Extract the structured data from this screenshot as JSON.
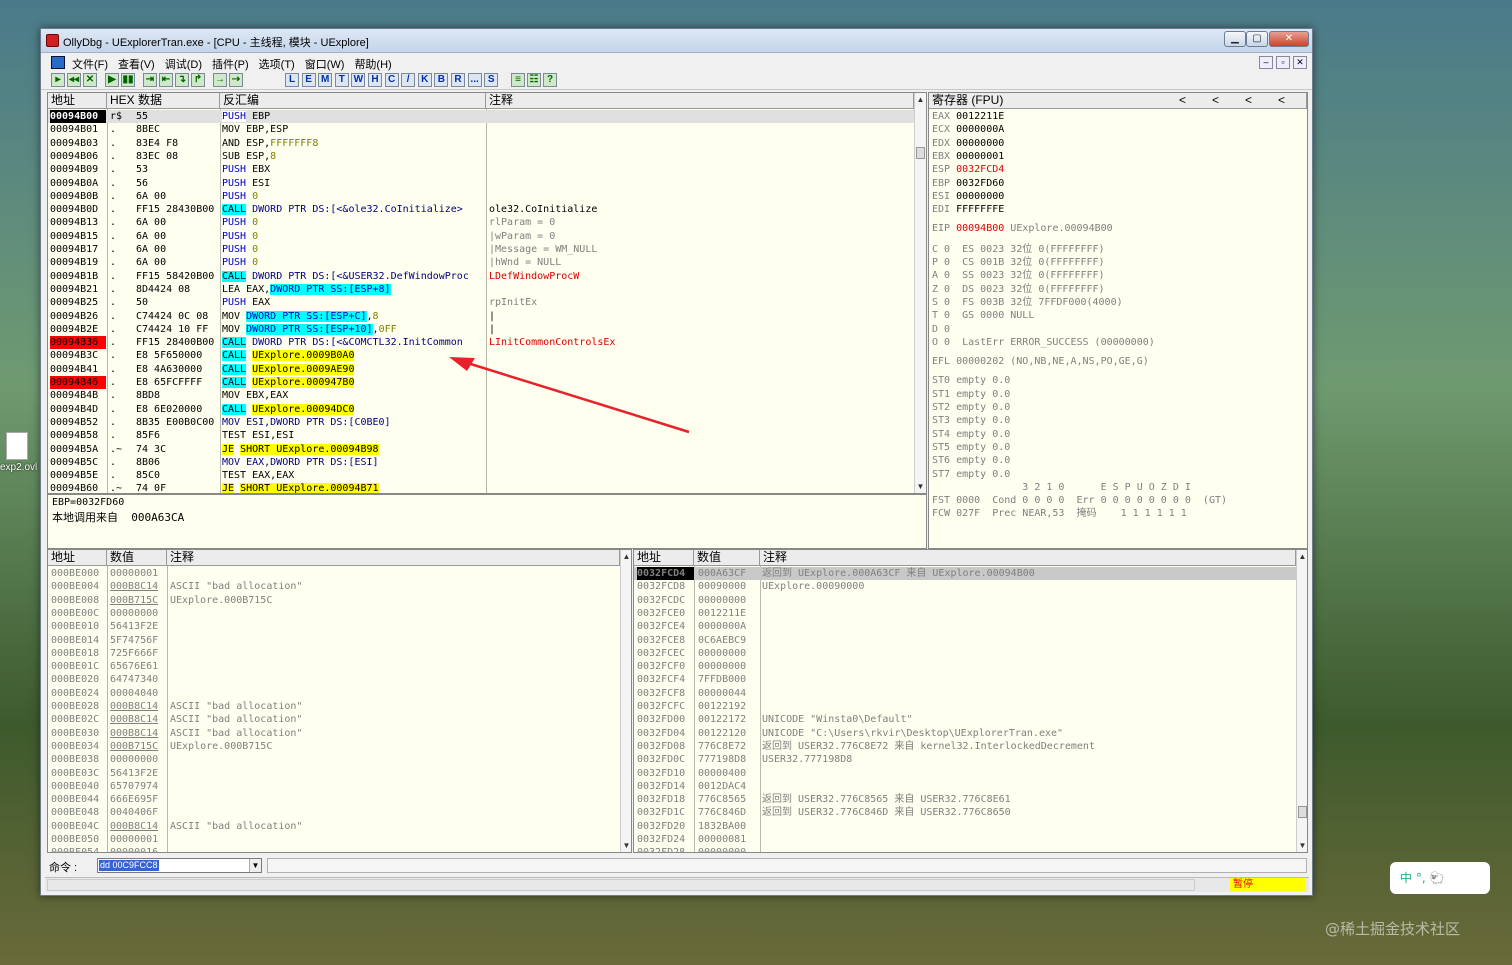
{
  "window": {
    "title": "OllyDbg - UExplorerTran.exe - [CPU - 主线程, 模块 - UExplore]",
    "min": "▁",
    "max": "▢",
    "close": "✕"
  },
  "menu": [
    "文件(F)",
    "查看(V)",
    "调试(D)",
    "插件(P)",
    "选项(T)",
    "窗口(W)",
    "帮助(H)"
  ],
  "mdi_buttons": [
    "‒",
    "▫",
    "✕"
  ],
  "toolbar": {
    "controls": [
      "▸",
      "◂◂",
      "✕",
      "▶",
      "▮▮",
      "⇥",
      "⇤",
      "↴",
      "↱",
      "→",
      "⇢"
    ],
    "windows": [
      "L",
      "E",
      "M",
      "T",
      "W",
      "H",
      "C",
      "/",
      "K",
      "B",
      "R",
      "...",
      "S"
    ],
    "extra": [
      "≡",
      "☷",
      "?"
    ]
  },
  "desktop": {
    "file_label": "exp2.ovl"
  },
  "cpu": {
    "headers": {
      "addr": "地址",
      "hex": "HEX 数据",
      "disasm": "反汇编",
      "comment": "注释"
    },
    "rows": [
      {
        "addr": "00094B00",
        "mark": "r$",
        "hex": "55",
        "disasm": [
          [
            "PUSH",
            "c"
          ],
          [
            " EBP",
            ""
          ]
        ],
        "comment": "",
        "addr_style": "sel"
      },
      {
        "addr": "00094B01",
        "mark": ".",
        "hex": "8BEC",
        "disasm": [
          [
            "MOV EBP,ESP",
            ""
          ]
        ],
        "comment": ""
      },
      {
        "addr": "00094B03",
        "mark": ".",
        "hex": "83E4 F8",
        "disasm": [
          [
            "AND ESP,",
            ""
          ],
          [
            "FFFFFFF8",
            "o"
          ]
        ],
        "comment": ""
      },
      {
        "addr": "00094B06",
        "mark": ".",
        "hex": "83EC 08",
        "disasm": [
          [
            "SUB ESP,",
            ""
          ],
          [
            "8",
            "o"
          ]
        ],
        "comment": ""
      },
      {
        "addr": "00094B09",
        "mark": ".",
        "hex": "53",
        "disasm": [
          [
            "PUSH",
            "c"
          ],
          [
            " EBX",
            ""
          ]
        ],
        "comment": ""
      },
      {
        "addr": "00094B0A",
        "mark": ".",
        "hex": "56",
        "disasm": [
          [
            "PUSH",
            "c"
          ],
          [
            " ESI",
            ""
          ]
        ],
        "comment": ""
      },
      {
        "addr": "00094B0B",
        "mark": ".",
        "hex": "6A 00",
        "disasm": [
          [
            "PUSH",
            "c"
          ],
          [
            " 0",
            "o"
          ]
        ],
        "comment": ""
      },
      {
        "addr": "00094B0D",
        "mark": ".",
        "hex": "FF15 28430B00",
        "disasm": [
          [
            "CALL",
            "cc"
          ],
          [
            " DWORD PTR DS:[<&ole32.CoInitialize>",
            "n"
          ]
        ],
        "comment": "ole32.CoInitialize"
      },
      {
        "addr": "00094B13",
        "mark": ".",
        "hex": "6A 00",
        "disasm": [
          [
            "PUSH",
            "c"
          ],
          [
            " 0",
            "o"
          ]
        ],
        "comment": "rlParam = 0",
        "cstyle": "g"
      },
      {
        "addr": "00094B15",
        "mark": ".",
        "hex": "6A 00",
        "disasm": [
          [
            "PUSH",
            "c"
          ],
          [
            " 0",
            "o"
          ]
        ],
        "comment": "|wParam = 0",
        "cstyle": "g"
      },
      {
        "addr": "00094B17",
        "mark": ".",
        "hex": "6A 00",
        "disasm": [
          [
            "PUSH",
            "c"
          ],
          [
            " 0",
            "o"
          ]
        ],
        "comment": "|Message = WM_NULL",
        "cstyle": "g"
      },
      {
        "addr": "00094B19",
        "mark": ".",
        "hex": "6A 00",
        "disasm": [
          [
            "PUSH",
            "c"
          ],
          [
            " 0",
            "o"
          ]
        ],
        "comment": "|hWnd = NULL",
        "cstyle": "g"
      },
      {
        "addr": "00094B1B",
        "mark": ".",
        "hex": "FF15 58420B00",
        "disasm": [
          [
            "CALL",
            "cc"
          ],
          [
            " DWORD PTR DS:[<&USER32.DefWindowProc",
            "n"
          ]
        ],
        "comment": "LDefWindowProcW",
        "cstyle": "r"
      },
      {
        "addr": "00094B21",
        "mark": ".",
        "hex": "8D4424 08",
        "disasm": [
          [
            "LEA EAX,",
            ""
          ],
          [
            "DWORD PTR SS:[ESP+8]",
            "cb"
          ]
        ],
        "comment": ""
      },
      {
        "addr": "00094B25",
        "mark": ".",
        "hex": "50",
        "disasm": [
          [
            "PUSH",
            "c"
          ],
          [
            " EAX",
            ""
          ]
        ],
        "comment": "rpInitEx",
        "cstyle": "g"
      },
      {
        "addr": "00094B26",
        "mark": ".",
        "hex": "C74424 0C 08",
        "disasm": [
          [
            "MOV ",
            ""
          ],
          [
            "DWORD PTR SS:[ESP+C]",
            "cb"
          ],
          [
            ",",
            ""
          ],
          [
            "8",
            "o"
          ]
        ],
        "comment": "|"
      },
      {
        "addr": "00094B2E",
        "mark": ".",
        "hex": "C74424 10 FF",
        "disasm": [
          [
            "MOV ",
            ""
          ],
          [
            "DWORD PTR SS:[ESP+10]",
            "cb"
          ],
          [
            ",",
            ""
          ],
          [
            "0FF",
            "o"
          ]
        ],
        "comment": "|"
      },
      {
        "addr": "00094B36",
        "mark": ".",
        "hex": "FF15 28400B00",
        "disasm": [
          [
            "CALL",
            "cc"
          ],
          [
            " DWORD PTR DS:[<&COMCTL32.InitCommon",
            "n"
          ]
        ],
        "comment": "LInitCommonControlsEx",
        "cstyle": "r",
        "addr_style": "red"
      },
      {
        "addr": "00094B3C",
        "mark": ".",
        "hex": "E8 5F650000",
        "disasm": [
          [
            "CALL",
            "cc"
          ],
          [
            " ",
            ""
          ],
          [
            "UExplore.0009B0A0",
            "y"
          ]
        ],
        "comment": ""
      },
      {
        "addr": "00094B41",
        "mark": ".",
        "hex": "E8 4A630000",
        "disasm": [
          [
            "CALL",
            "cc"
          ],
          [
            " ",
            ""
          ],
          [
            "UExplore.0009AE90",
            "y"
          ]
        ],
        "comment": ""
      },
      {
        "addr": "00094B46",
        "mark": ".",
        "hex": "E8 65FCFFFF",
        "disasm": [
          [
            "CALL",
            "cc"
          ],
          [
            " ",
            ""
          ],
          [
            "UExplore.000947B0",
            "y"
          ]
        ],
        "comment": "",
        "addr_style": "red"
      },
      {
        "addr": "00094B4B",
        "mark": ".",
        "hex": "8BD8",
        "disasm": [
          [
            "MOV EBX,EAX",
            ""
          ]
        ],
        "comment": ""
      },
      {
        "addr": "00094B4D",
        "mark": ".",
        "hex": "E8 6E020000",
        "disasm": [
          [
            "CALL",
            "cc"
          ],
          [
            " ",
            ""
          ],
          [
            "UExplore.00094DC0",
            "y"
          ]
        ],
        "comment": ""
      },
      {
        "addr": "00094B52",
        "mark": ".",
        "hex": "8B35 E00B0C00",
        "disasm": [
          [
            "MOV ESI,DWORD PTR DS:[C0BE0]",
            "n"
          ]
        ],
        "comment": ""
      },
      {
        "addr": "00094B58",
        "mark": ".",
        "hex": "85F6",
        "disasm": [
          [
            "TEST ESI,ESI",
            ""
          ]
        ],
        "comment": ""
      },
      {
        "addr": "00094B5A",
        "mark": ".~",
        "hex": "74 3C",
        "disasm": [
          [
            "JE",
            "y"
          ],
          [
            " ",
            ""
          ],
          [
            "SHORT UExplore.00094B98",
            "y"
          ]
        ],
        "comment": ""
      },
      {
        "addr": "00094B5C",
        "mark": ".",
        "hex": "8B06",
        "disasm": [
          [
            "MOV EAX,DWORD PTR DS:[ESI]",
            "n"
          ]
        ],
        "comment": ""
      },
      {
        "addr": "00094B5E",
        "mark": ".",
        "hex": "85C0",
        "disasm": [
          [
            "TEST EAX,EAX",
            ""
          ]
        ],
        "comment": ""
      },
      {
        "addr": "00094B60",
        "mark": ".~",
        "hex": "74 0F",
        "disasm": [
          [
            "JE",
            "y"
          ],
          [
            " ",
            ""
          ],
          [
            "SHORT UExplore.00094B71",
            "y"
          ]
        ],
        "comment": ""
      }
    ],
    "info1": "EBP=0032FD60",
    "info2": "本地调用来自  000A63CA"
  },
  "registers": {
    "header": "寄存器 (FPU)",
    "nav": [
      "<",
      "<",
      "<",
      "<"
    ],
    "gpr": [
      {
        "n": "EAX",
        "v": "0012211E"
      },
      {
        "n": "ECX",
        "v": "0000000A"
      },
      {
        "n": "EDX",
        "v": "00000000"
      },
      {
        "n": "EBX",
        "v": "00000001"
      },
      {
        "n": "ESP",
        "v": "0032FCD4",
        "red": true
      },
      {
        "n": "EBP",
        "v": "0032FD60"
      },
      {
        "n": "ESI",
        "v": "00000000"
      },
      {
        "n": "EDI",
        "v": "FFFFFFFE"
      }
    ],
    "eip": {
      "n": "EIP",
      "v": "00094B00",
      "c": "UExplore.00094B00"
    },
    "flags": [
      "C 0  ES 0023 32位 0(FFFFFFFF)",
      "P 0  CS 001B 32位 0(FFFFFFFF)",
      "A 0  SS 0023 32位 0(FFFFFFFF)",
      "Z 0  DS 0023 32位 0(FFFFFFFF)",
      "S 0  FS 003B 32位 7FFDF000(4000)",
      "T 0  GS 0000 NULL",
      "D 0",
      "O 0  LastErr ERROR_SUCCESS (00000000)"
    ],
    "efl": "EFL 00000202 (NO,NB,NE,A,NS,PO,GE,G)",
    "fpu": [
      "ST0 empty 0.0",
      "ST1 empty 0.0",
      "ST2 empty 0.0",
      "ST3 empty 0.0",
      "ST4 empty 0.0",
      "ST5 empty 0.0",
      "ST6 empty 0.0",
      "ST7 empty 0.0"
    ],
    "fst_head": "               3 2 1 0      E S P U O Z D I",
    "fst": "FST 0000  Cond 0 0 0 0  Err 0 0 0 0 0 0 0 0  (GT)",
    "fcw": "FCW 027F  Prec NEAR,53  掩码    1 1 1 1 1 1"
  },
  "dump": {
    "headers": {
      "addr": "地址",
      "val": "数值",
      "comment": "注释"
    },
    "rows": [
      [
        "000BE000",
        "00000001",
        ""
      ],
      [
        "000BE004",
        "000B8C14",
        "ASCII \"bad allocation\""
      ],
      [
        "000BE008",
        "000B715C",
        "UExplore.000B715C"
      ],
      [
        "000BE00C",
        "00000000",
        ""
      ],
      [
        "000BE010",
        "56413F2E",
        ""
      ],
      [
        "000BE014",
        "5F74756F",
        ""
      ],
      [
        "000BE018",
        "725F666F",
        ""
      ],
      [
        "000BE01C",
        "65676E61",
        ""
      ],
      [
        "000BE020",
        "64747340",
        ""
      ],
      [
        "000BE024",
        "00004040",
        ""
      ],
      [
        "000BE028",
        "000B8C14",
        "ASCII \"bad allocation\""
      ],
      [
        "000BE02C",
        "000B8C14",
        "ASCII \"bad allocation\""
      ],
      [
        "000BE030",
        "000B8C14",
        "ASCII \"bad allocation\""
      ],
      [
        "000BE034",
        "000B715C",
        "UExplore.000B715C"
      ],
      [
        "000BE038",
        "00000000",
        ""
      ],
      [
        "000BE03C",
        "56413F2E",
        ""
      ],
      [
        "000BE040",
        "65707974",
        ""
      ],
      [
        "000BE044",
        "666E695F",
        ""
      ],
      [
        "000BE048",
        "0040406F",
        ""
      ],
      [
        "000BE04C",
        "000B8C14",
        "ASCII \"bad allocation\""
      ],
      [
        "000BE050",
        "00000001",
        ""
      ],
      [
        "000BE054",
        "00000016",
        ""
      ]
    ]
  },
  "stack": {
    "headers": {
      "addr": "地址",
      "val": "数值",
      "comment": "注释"
    },
    "rows": [
      [
        "0032FCD4",
        "000A63CF",
        "返回到 UExplore.000A63CF 来自 UExplore.00094B00"
      ],
      [
        "0032FCD8",
        "00090000",
        "UExplore.00090000"
      ],
      [
        "0032FCDC",
        "00000000",
        ""
      ],
      [
        "0032FCE0",
        "0012211E",
        ""
      ],
      [
        "0032FCE4",
        "0000000A",
        ""
      ],
      [
        "0032FCE8",
        "0C6AEBC9",
        ""
      ],
      [
        "0032FCEC",
        "00000000",
        ""
      ],
      [
        "0032FCF0",
        "00000000",
        ""
      ],
      [
        "0032FCF4",
        "7FFDB000",
        ""
      ],
      [
        "0032FCF8",
        "00000044",
        ""
      ],
      [
        "0032FCFC",
        "00122192",
        ""
      ],
      [
        "0032FD00",
        "00122172",
        "UNICODE \"Winsta0\\Default\""
      ],
      [
        "0032FD04",
        "00122120",
        "UNICODE \"C:\\Users\\rkvir\\Desktop\\UExplorerTran.exe\""
      ],
      [
        "0032FD08",
        "776C8E72",
        "返回到 USER32.776C8E72 来自 kernel32.InterlockedDecrement"
      ],
      [
        "0032FD0C",
        "777198D8",
        "USER32.777198D8"
      ],
      [
        "0032FD10",
        "00000400",
        ""
      ],
      [
        "0032FD14",
        "0012DAC4",
        ""
      ],
      [
        "0032FD18",
        "776C8565",
        "返回到 USER32.776C8565 来自 USER32.776C8E61"
      ],
      [
        "0032FD1C",
        "776C846D",
        "返回到 USER32.776C846D 来自 USER32.776C8650"
      ],
      [
        "0032FD20",
        "1832BA00",
        ""
      ],
      [
        "0032FD24",
        "00000081",
        ""
      ],
      [
        "0032FD28",
        "00000000",
        ""
      ]
    ]
  },
  "command": {
    "label": "命令 :",
    "value": "dd 00C9FCC8"
  },
  "status": {
    "state": "暂停"
  },
  "ime": {
    "text": "中 °, 🐑"
  },
  "watermark": "@稀土掘金技术社区",
  "colors": {
    "call_bg": "#00ffff",
    "jump_bg": "#ffff00",
    "breakpoint": "#ff0000",
    "pane_bg": "#fffff0",
    "arrow": "#e8212b"
  }
}
